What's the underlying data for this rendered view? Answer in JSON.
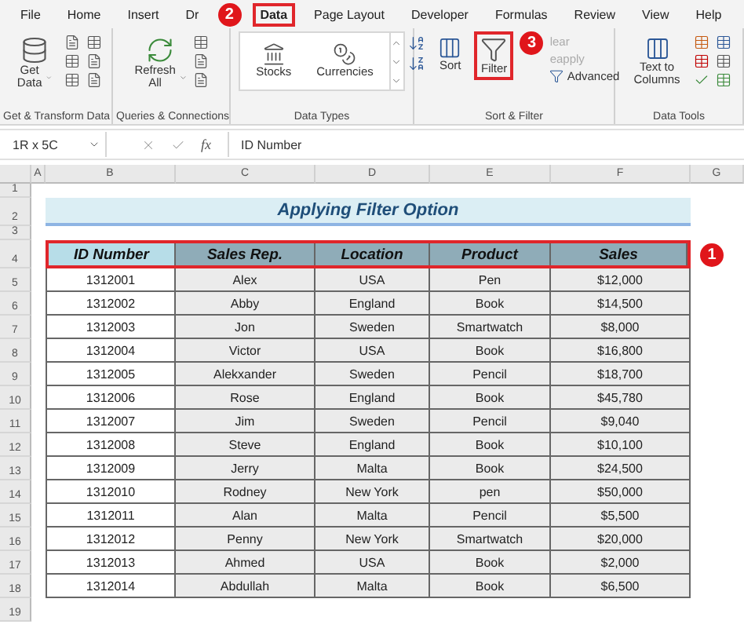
{
  "tabs": [
    {
      "label": "File",
      "selected": false
    },
    {
      "label": "Home",
      "selected": false
    },
    {
      "label": "Insert",
      "selected": false
    },
    {
      "label": "Dr",
      "selected": false
    },
    {
      "label": "Data",
      "selected": true,
      "callout": "2"
    },
    {
      "label": "Page Layout",
      "selected": false
    },
    {
      "label": "Developer",
      "selected": false
    },
    {
      "label": "Formulas",
      "selected": false
    },
    {
      "label": "Review",
      "selected": false
    },
    {
      "label": "View",
      "selected": false
    },
    {
      "label": "Help",
      "selected": false
    }
  ],
  "ribbon": {
    "get_transform": {
      "button": "Get Data",
      "group": "Get & Transform Data"
    },
    "queries": {
      "button": "Refresh All",
      "group": "Queries & Connections"
    },
    "data_types": {
      "items": [
        "Stocks",
        "Currencies"
      ],
      "group": "Data Types"
    },
    "sort_filter": {
      "sort": "Sort",
      "filter": {
        "label": "Filter",
        "outlined": true,
        "callout": "3"
      },
      "clear": {
        "label": "lear",
        "disabled": true
      },
      "reapply": {
        "label": "eapply",
        "disabled": true
      },
      "advanced": "Advanced",
      "group": "Sort & Filter"
    },
    "data_tools": {
      "button": "Text to Columns",
      "group": "Data Tools"
    }
  },
  "formula_bar": {
    "name_box": "1R x 5C",
    "function_label": "fx",
    "value": "ID Number"
  },
  "sheet": {
    "column_headers": [
      "A",
      "B",
      "C",
      "D",
      "E",
      "F",
      "G"
    ],
    "row_numbers": [
      "1",
      "2",
      "3",
      "4",
      "5",
      "6",
      "7",
      "8",
      "9",
      "10",
      "11",
      "12",
      "13",
      "14",
      "15",
      "16",
      "17",
      "18",
      "19"
    ],
    "title": "Applying Filter Option",
    "header_outlined": true,
    "header_callout": "1",
    "columns": [
      {
        "label": "ID Number",
        "active": true
      },
      {
        "label": "Sales Rep.",
        "active": false
      },
      {
        "label": "Location",
        "active": false
      },
      {
        "label": "Product",
        "active": false
      },
      {
        "label": "Sales",
        "active": false
      }
    ],
    "rows": [
      [
        "1312001",
        "Alex",
        "USA",
        "Pen",
        "$12,000"
      ],
      [
        "1312002",
        "Abby",
        "England",
        "Book",
        "$14,500"
      ],
      [
        "1312003",
        "Jon",
        "Sweden",
        "Smartwatch",
        "$8,000"
      ],
      [
        "1312004",
        "Victor",
        "USA",
        "Book",
        "$16,800"
      ],
      [
        "1312005",
        "Alekxander",
        "Sweden",
        "Pencil",
        "$18,700"
      ],
      [
        "1312006",
        "Rose",
        "England",
        "Book",
        "$45,780"
      ],
      [
        "1312007",
        "Jim",
        "Sweden",
        "Pencil",
        "$9,040"
      ],
      [
        "1312008",
        "Steve",
        "England",
        "Book",
        "$10,100"
      ],
      [
        "1312009",
        "Jerry",
        "Malta",
        "Book",
        "$24,500"
      ],
      [
        "1312010",
        "Rodney",
        "New York",
        "pen",
        "$50,000"
      ],
      [
        "1312011",
        "Alan",
        "Malta",
        "Pencil",
        "$5,500"
      ],
      [
        "1312012",
        "Penny",
        "New York",
        "Smartwatch",
        "$20,000"
      ],
      [
        "1312013",
        "Ahmed",
        "USA",
        "Book",
        "$2,000"
      ],
      [
        "1312014",
        "Abdullah",
        "Malta",
        "Book",
        "$6,500"
      ]
    ]
  }
}
